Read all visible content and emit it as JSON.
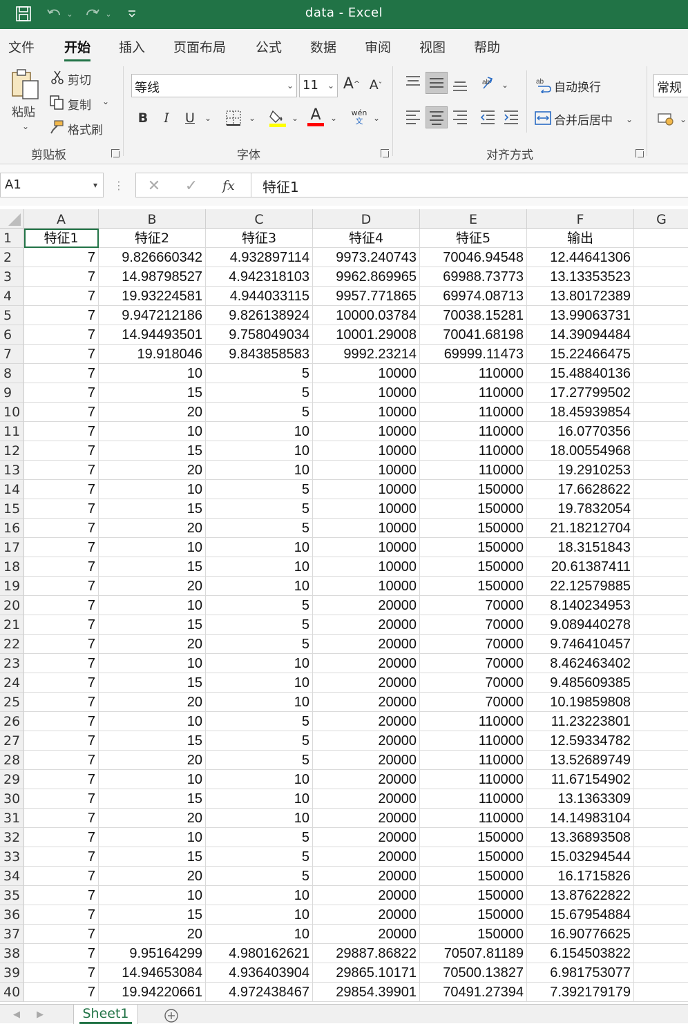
{
  "titlebar": {
    "title": "data - Excel",
    "save_icon": "save-icon",
    "undo_icon": "undo-icon",
    "redo_icon": "redo-icon",
    "customize_icon": "customize-qat-icon"
  },
  "menu": [
    "文件",
    "开始",
    "插入",
    "页面布局",
    "公式",
    "数据",
    "审阅",
    "视图",
    "帮助"
  ],
  "ribbon": {
    "clipboard": {
      "paste": "粘贴",
      "cut": "剪切",
      "copy": "复制",
      "format_painter": "格式刷",
      "group_label": "剪贴板"
    },
    "font": {
      "font_name": "等线",
      "font_size": "11",
      "grow": "A",
      "shrink": "A",
      "bold": "B",
      "italic": "I",
      "underline": "U",
      "fill_letter": "",
      "font_color_letter": "A",
      "phonetic_top": "wén",
      "phonetic_bottom": "文",
      "group_label": "字体",
      "fill_color": "#ffff00",
      "font_color": "#ff0000"
    },
    "alignment": {
      "wrap_text": "自动换行",
      "merge_center": "合并后居中",
      "group_label": "对齐方式"
    },
    "number": {
      "format": "常规"
    }
  },
  "formula_bar": {
    "name_box": "A1",
    "fx": "fx",
    "content": "特征1"
  },
  "columns": [
    "A",
    "B",
    "C",
    "D",
    "E",
    "F",
    "G"
  ],
  "header_row": [
    "特征1",
    "特征2",
    "特征3",
    "特征4",
    "特征5",
    "输出"
  ],
  "rows": [
    [
      "7",
      "9.826660342",
      "4.932897114",
      "9973.240743",
      "70046.94548",
      "12.44641306"
    ],
    [
      "7",
      "14.98798527",
      "4.942318103",
      "9962.869965",
      "69988.73773",
      "13.13353523"
    ],
    [
      "7",
      "19.93224581",
      "4.944033115",
      "9957.771865",
      "69974.08713",
      "13.80172389"
    ],
    [
      "7",
      "9.947212186",
      "9.826138924",
      "10000.03784",
      "70038.15281",
      "13.99063731"
    ],
    [
      "7",
      "14.94493501",
      "9.758049034",
      "10001.29008",
      "70041.68198",
      "14.39094484"
    ],
    [
      "7",
      "19.918046",
      "9.843858583",
      "9992.23214",
      "69999.11473",
      "15.22466475"
    ],
    [
      "7",
      "10",
      "5",
      "10000",
      "110000",
      "15.48840136"
    ],
    [
      "7",
      "15",
      "5",
      "10000",
      "110000",
      "17.27799502"
    ],
    [
      "7",
      "20",
      "5",
      "10000",
      "110000",
      "18.45939854"
    ],
    [
      "7",
      "10",
      "10",
      "10000",
      "110000",
      "16.0770356"
    ],
    [
      "7",
      "15",
      "10",
      "10000",
      "110000",
      "18.00554968"
    ],
    [
      "7",
      "20",
      "10",
      "10000",
      "110000",
      "19.2910253"
    ],
    [
      "7",
      "10",
      "5",
      "10000",
      "150000",
      "17.6628622"
    ],
    [
      "7",
      "15",
      "5",
      "10000",
      "150000",
      "19.7832054"
    ],
    [
      "7",
      "20",
      "5",
      "10000",
      "150000",
      "21.18212704"
    ],
    [
      "7",
      "10",
      "10",
      "10000",
      "150000",
      "18.3151843"
    ],
    [
      "7",
      "15",
      "10",
      "10000",
      "150000",
      "20.61387411"
    ],
    [
      "7",
      "20",
      "10",
      "10000",
      "150000",
      "22.12579885"
    ],
    [
      "7",
      "10",
      "5",
      "20000",
      "70000",
      "8.140234953"
    ],
    [
      "7",
      "15",
      "5",
      "20000",
      "70000",
      "9.089440278"
    ],
    [
      "7",
      "20",
      "5",
      "20000",
      "70000",
      "9.746410457"
    ],
    [
      "7",
      "10",
      "10",
      "20000",
      "70000",
      "8.462463402"
    ],
    [
      "7",
      "15",
      "10",
      "20000",
      "70000",
      "9.485609385"
    ],
    [
      "7",
      "20",
      "10",
      "20000",
      "70000",
      "10.19859808"
    ],
    [
      "7",
      "10",
      "5",
      "20000",
      "110000",
      "11.23223801"
    ],
    [
      "7",
      "15",
      "5",
      "20000",
      "110000",
      "12.59334782"
    ],
    [
      "7",
      "20",
      "5",
      "20000",
      "110000",
      "13.52689749"
    ],
    [
      "7",
      "10",
      "10",
      "20000",
      "110000",
      "11.67154902"
    ],
    [
      "7",
      "15",
      "10",
      "20000",
      "110000",
      "13.1363309"
    ],
    [
      "7",
      "20",
      "10",
      "20000",
      "110000",
      "14.14983104"
    ],
    [
      "7",
      "10",
      "5",
      "20000",
      "150000",
      "13.36893508"
    ],
    [
      "7",
      "15",
      "5",
      "20000",
      "150000",
      "15.03294544"
    ],
    [
      "7",
      "20",
      "5",
      "20000",
      "150000",
      "16.1715826"
    ],
    [
      "7",
      "10",
      "10",
      "20000",
      "150000",
      "13.87622822"
    ],
    [
      "7",
      "15",
      "10",
      "20000",
      "150000",
      "15.67954884"
    ],
    [
      "7",
      "20",
      "10",
      "20000",
      "150000",
      "16.90776625"
    ],
    [
      "7",
      "9.95164299",
      "4.980162621",
      "29887.86822",
      "70507.81189",
      "6.154503822"
    ],
    [
      "7",
      "14.94653084",
      "4.936403904",
      "29865.10171",
      "70500.13827",
      "6.981753077"
    ],
    [
      "7",
      "19.94220661",
      "4.972438467",
      "29854.39901",
      "70491.27394",
      "7.392179179"
    ]
  ],
  "sheets": {
    "active": "Sheet1",
    "add_icon": "add-sheet-icon"
  }
}
